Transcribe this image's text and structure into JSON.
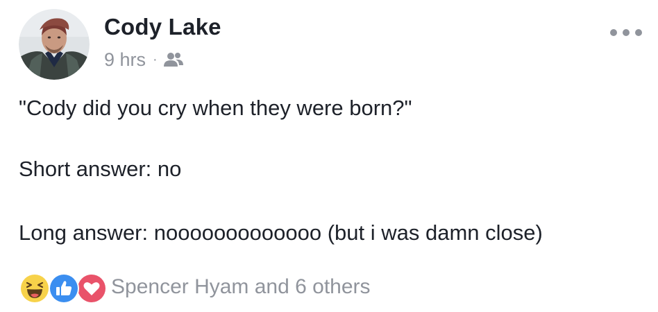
{
  "post": {
    "author": "Cody Lake",
    "time": "9 hrs",
    "separator": "·",
    "audience_icon": "friends-icon",
    "more_icon": "more-options-icon",
    "lines": [
      "\"Cody did you cry when they were born?\"",
      "Short answer: no",
      "Long answer: nooooooooooooo (but i was damn close)"
    ]
  },
  "reactions": {
    "icons": [
      "haha-icon",
      "like-icon",
      "love-icon"
    ],
    "summary": "Spencer Hyam and 6 others"
  },
  "colors": {
    "text": "#1d2129",
    "muted": "#90949c",
    "like_blue": "#3b8ef0",
    "love_red": "#e9536a",
    "haha_yellow": "#f7d24a"
  }
}
